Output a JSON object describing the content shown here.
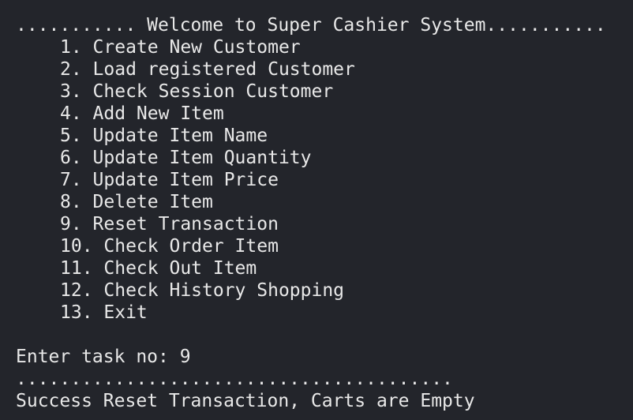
{
  "header": {
    "welcome": "........... Welcome to Super Cashier System..........."
  },
  "menu": {
    "items": [
      {
        "label": "1. Create New Customer"
      },
      {
        "label": "2. Load registered Customer"
      },
      {
        "label": "3. Check Session Customer"
      },
      {
        "label": "4. Add New Item"
      },
      {
        "label": "5. Update Item Name"
      },
      {
        "label": "6. Update Item Quantity"
      },
      {
        "label": "7. Update Item Price"
      },
      {
        "label": "8. Delete Item"
      },
      {
        "label": "9. Reset Transaction"
      },
      {
        "label": "10. Check Order Item"
      },
      {
        "label": "11. Check Out Item"
      },
      {
        "label": "12. Check History Shopping"
      },
      {
        "label": "13. Exit"
      }
    ]
  },
  "prompt": {
    "text": "Enter task no: 9"
  },
  "output": {
    "separator": "........................................",
    "message": "Success Reset Transaction, Carts are Empty"
  }
}
